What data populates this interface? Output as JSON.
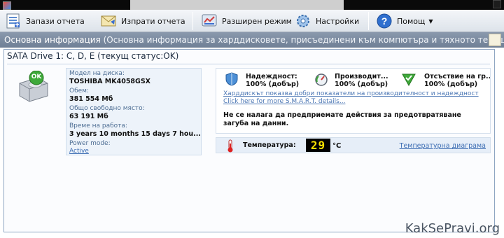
{
  "toolbar": {
    "save_label": "Запази отчета",
    "send_label": "Изпрати отчета",
    "advanced_label": "Разширен режим",
    "settings_label": "Настройки",
    "help_label": "Помощ"
  },
  "infobar": {
    "title": "Основна информация",
    "subtitle": " (Основна информация за харддисковете, присъединени към компютъра и  тяхното текущо..."
  },
  "drive": {
    "title": "SATA Drive 1: C, D, E (текущ статус:OK)",
    "status_badge": "OK",
    "model_label": "Модел на диска:",
    "model_value": "TOSHIBA MK4058GSX",
    "volume_label": "Обем:",
    "volume_value": "381 554 Mб",
    "free_label": "Общо свободно място:",
    "free_value": "63 191 Mб",
    "uptime_label": "Време на работа:",
    "uptime_value": "3 years 10 months 15 days 7 hou...",
    "power_label": "Power mode:",
    "power_value": "Active"
  },
  "status": {
    "reliability_title": "Надеждност:",
    "reliability_value": "100% (добър)",
    "performance_title": "Производит...",
    "performance_value": "100% (добър)",
    "errors_title": "Отсъствие на гр...",
    "errors_value": "100% (добър)",
    "smart_link": "Харддискът показва добри показатели на производителност и надеждност Click here for more S.M.A.R.T. details...",
    "advice": "Не се налага да предприемате действия за предотвратяване загуба на данни."
  },
  "temperature": {
    "label": "Температура:",
    "value": "29",
    "unit": "°C",
    "chart_link": "Температурна диаграма"
  },
  "watermark": "KakSePravi.org",
  "colors": {
    "infobar": "#7b8aa0",
    "link": "#3f6fb4",
    "ok_green": "#3ea93a",
    "temp_digits": "#f7e000"
  }
}
